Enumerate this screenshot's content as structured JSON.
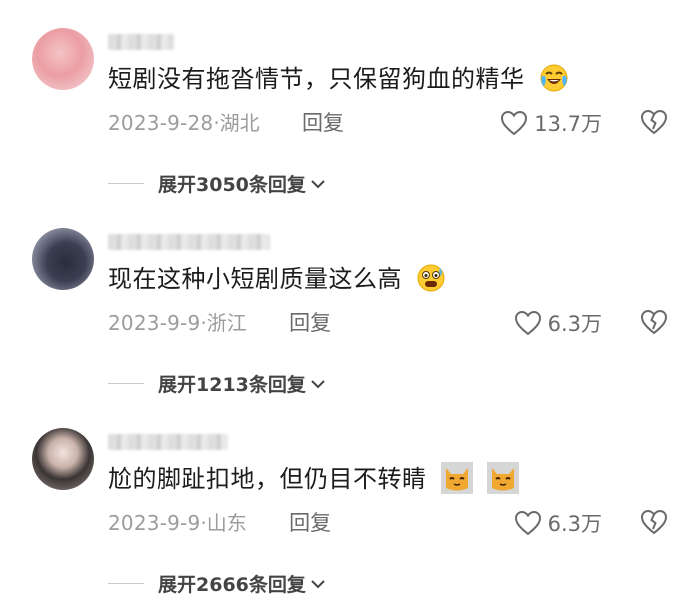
{
  "comments": [
    {
      "content": "短剧没有拖沓情节，只保留狗血的精华",
      "emoji": "crying-laughing-emoji",
      "date": "2023-9-28",
      "location": "湖北",
      "reply_label": "回复",
      "likes": "13.7万",
      "expand": "展开3050条回复"
    },
    {
      "content": "现在这种小短剧质量这么高",
      "emoji": "shocked-emoji",
      "date": "2023-9-9",
      "location": "浙江",
      "reply_label": "回复",
      "likes": "6.3万",
      "expand": "展开1213条回复"
    },
    {
      "content": "尬的脚趾扣地，但仍目不转睛",
      "emoji": "cat-emoji",
      "date": "2023-9-9",
      "location": "山东",
      "reply_label": "回复",
      "likes": "6.3万",
      "expand": "展开2666条回复"
    }
  ],
  "separator": "·",
  "colors": {
    "text": "#1c1c1c",
    "meta": "#9c9c9c",
    "action": "#6a6a6a"
  }
}
